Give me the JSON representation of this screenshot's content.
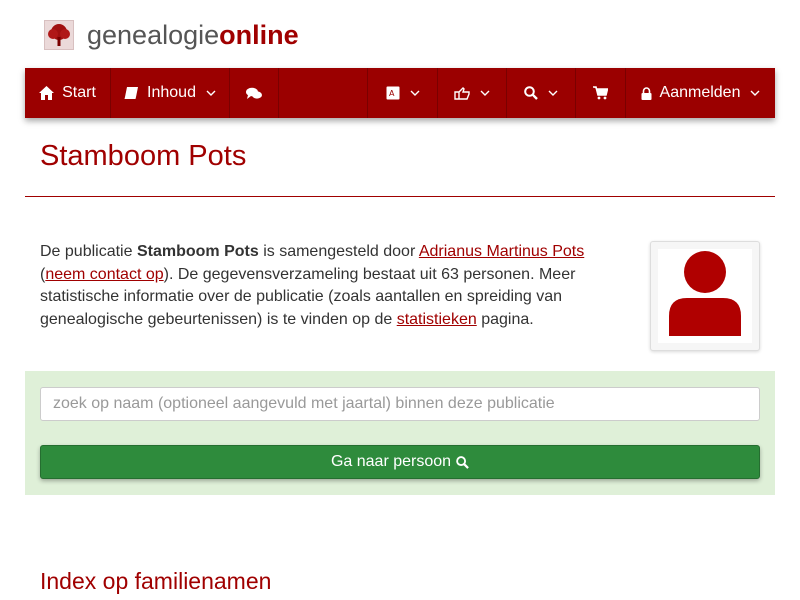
{
  "logo": {
    "part1": "genealogie",
    "part2": "online"
  },
  "nav": {
    "start": "Start",
    "inhoud": "Inhoud",
    "login": "Aanmelden"
  },
  "page": {
    "title": "Stamboom Pots"
  },
  "intro": {
    "t1": "De publicatie ",
    "pub": "Stamboom Pots",
    "t2": " is samengesteld door ",
    "author": "Adrianus Martinus Pots",
    "t3": " (",
    "contact": "neem contact op",
    "t4": "). De gegevensverzameling bestaat uit 63 personen. Meer statistische informatie over de publicatie (zoals aantallen en spreiding van genealogische gebeurtenissen) is te vinden op de ",
    "stats": "statistieken",
    "t5": " pagina."
  },
  "search": {
    "placeholder": "zoek op naam (optioneel aangevuld met jaartal) binnen deze publicatie",
    "button": "Ga naar persoon"
  },
  "sections": {
    "surnames": "Index op familienamen"
  },
  "colors": {
    "brand": "#9b0000",
    "heading": "#a00000",
    "panel": "#dff0d8",
    "button": "#2e8b3c"
  }
}
